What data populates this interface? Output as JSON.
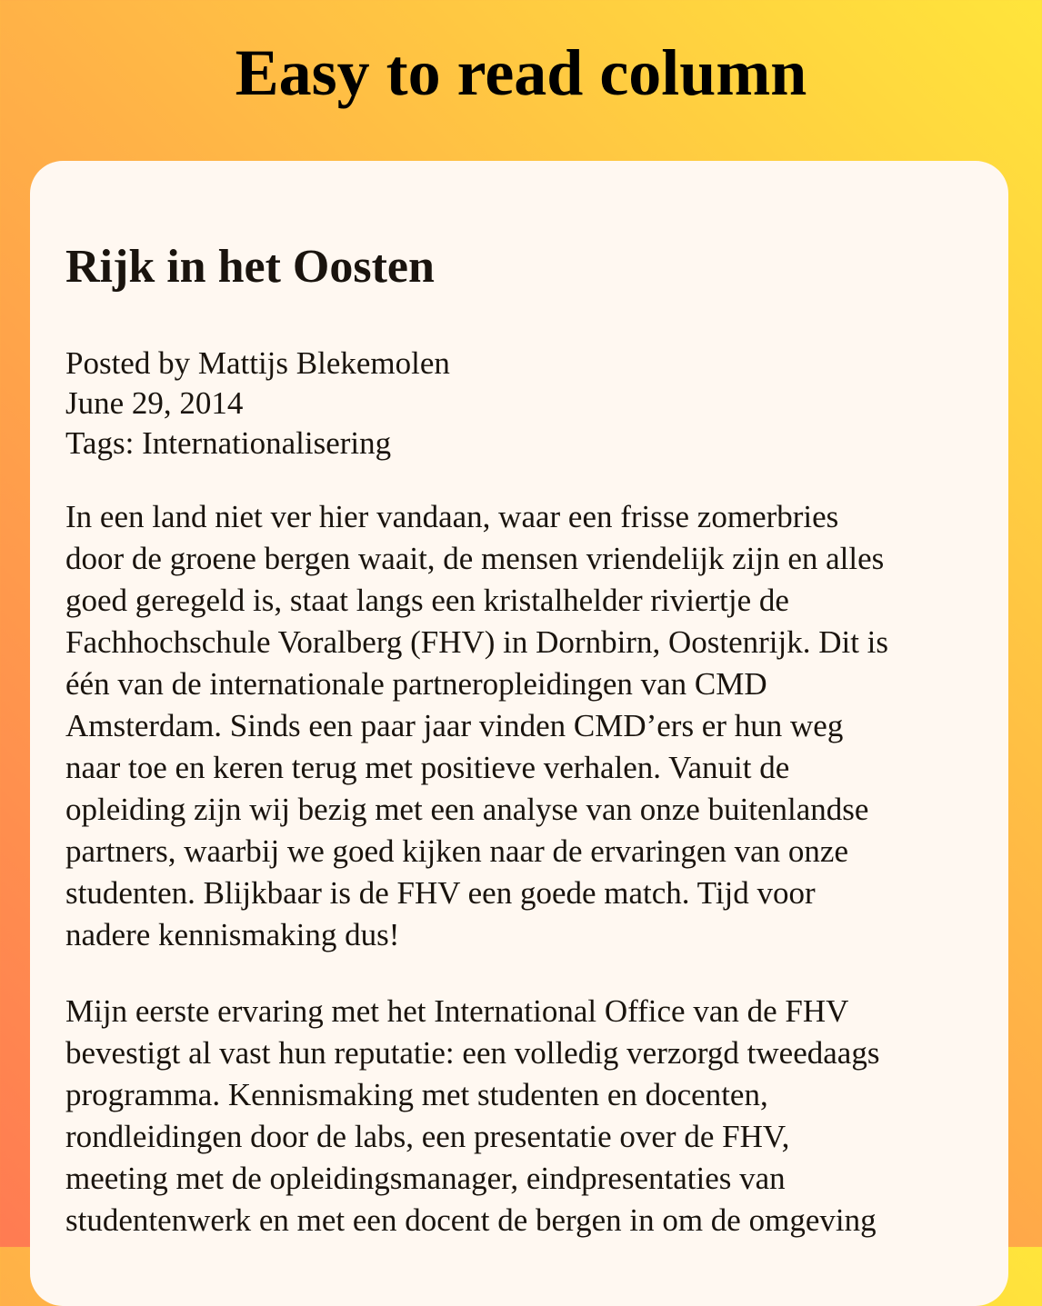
{
  "page": {
    "title": "Easy to read column"
  },
  "article": {
    "title": "Rijk in het Oosten",
    "posted_by": "Posted by Mattijs Blekemolen",
    "date": "June 29, 2014",
    "tags": "Tags: Internationalisering",
    "paragraphs": [
      {
        "lines": [
          "In een land niet ver hier vandaan, waar een frisse zomerbries",
          "door de groene bergen waait, de mensen vriendelijk zijn en alles",
          "goed geregeld is, staat langs een kristalhelder riviertje de",
          "Fachhochschule Voralberg (FHV) in Dornbirn, Oostenrijk. Dit is",
          "één van de internationale partneropleidingen van CMD",
          "Amsterdam. Sinds een paar jaar vinden CMD’ers er hun weg",
          "naar toe en keren terug met positieve verhalen. Vanuit de",
          "opleiding zijn wij bezig met een analyse van onze buitenlandse",
          "partners, waarbij we goed kijken naar de ervaringen van onze",
          "studenten. Blijkbaar is de FHV een goede match. Tijd voor",
          "nadere kennismaking dus!"
        ]
      },
      {
        "lines": [
          "Mijn eerste ervaring met het International Office van de FHV",
          "bevestigt al vast hun reputatie: een volledig verzorgd tweedaags",
          "programma. Kennismaking met studenten en docenten,",
          "rondleidingen door de labs, een presentatie over de FHV,",
          "meeting met de opleidingsmanager, eindpresentaties van",
          "studentenwerk en met een docent de bergen in om de omgeving"
        ]
      }
    ]
  }
}
